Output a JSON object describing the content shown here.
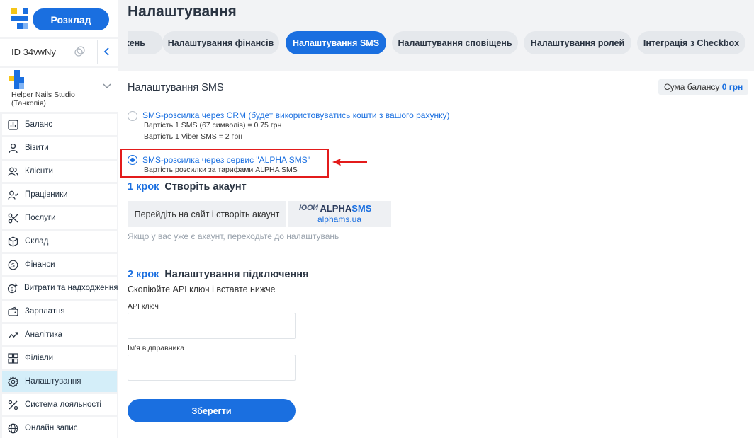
{
  "header": {
    "page_title": "Налаштування",
    "schedule_button": "Розклад"
  },
  "account": {
    "id_label": "ID 34vwNy",
    "studio_name": "Helper Nails Studio (Танкопія)"
  },
  "sidebar": {
    "items": [
      {
        "label": "Баланс",
        "icon": "chart-icon"
      },
      {
        "label": "Візити",
        "icon": "user-icon"
      },
      {
        "label": "Клієнти",
        "icon": "users-icon"
      },
      {
        "label": "Працівники",
        "icon": "user-check-icon"
      },
      {
        "label": "Послуги",
        "icon": "scissors-icon"
      },
      {
        "label": "Склад",
        "icon": "box-icon"
      },
      {
        "label": "Фінанси",
        "icon": "dollar-icon"
      },
      {
        "label": "Витрати та надходження",
        "icon": "coins-icon"
      },
      {
        "label": "Зарплатня",
        "icon": "wallet-icon"
      },
      {
        "label": "Аналітика",
        "icon": "trend-icon"
      },
      {
        "label": "Філіали",
        "icon": "grid-icon"
      },
      {
        "label": "Налаштування",
        "icon": "gear-icon",
        "active": true
      },
      {
        "label": "Система лояльності",
        "icon": "percent-icon"
      },
      {
        "label": "Онлайн запис",
        "icon": "globe-icon"
      }
    ]
  },
  "tabs": [
    {
      "label": "кень"
    },
    {
      "label": "Налаштування фінансів"
    },
    {
      "label": "Налаштування SMS",
      "active": true
    },
    {
      "label": "Налаштування сповіщень"
    },
    {
      "label": "Налаштування ролей"
    },
    {
      "label": "Інтеграція з Checkbox"
    }
  ],
  "sms": {
    "section_title": "Налаштування SMS",
    "balance_label": "Сума балансу",
    "balance_value": "0 грн",
    "option_crm": {
      "title": "SMS-розсилка через CRM (будет використовуватись кошти з вашого рахунку)",
      "line1": "Вартість 1 SMS (67 символів) = 0.75 грн",
      "line2": "Вартість 1 Viber SMS = 2 грн"
    },
    "option_alpha": {
      "title": "SMS-розсилка через сервис \"ALPHA SMS\"",
      "line1": "Вартість розсилки за тарифами ALPHA SMS"
    },
    "step1": {
      "num": "1 крок",
      "title": "Створіть акаунт",
      "button": "Перейдіть на сайт і створіть акаунт",
      "brand_mark": "ЮОИ",
      "brand_name_a": "ALPHA",
      "brand_name_b": "SMS",
      "link": "alphams.ua",
      "hint": "Якщо у вас уже є акаунт, переходьте до налаштувань"
    },
    "step2": {
      "num": "2 крок",
      "title": "Налаштування підключення",
      "desc": "Скопіюйте API ключ і вставте нижче",
      "api_label": "API ключ",
      "api_value": "",
      "sender_label": "Ім'я відправника",
      "sender_value": ""
    },
    "save_button": "Зберегти"
  },
  "colors": {
    "accent": "#1a6fe0",
    "highlight": "#e31b1b",
    "active_nav": "#d4eef9"
  }
}
